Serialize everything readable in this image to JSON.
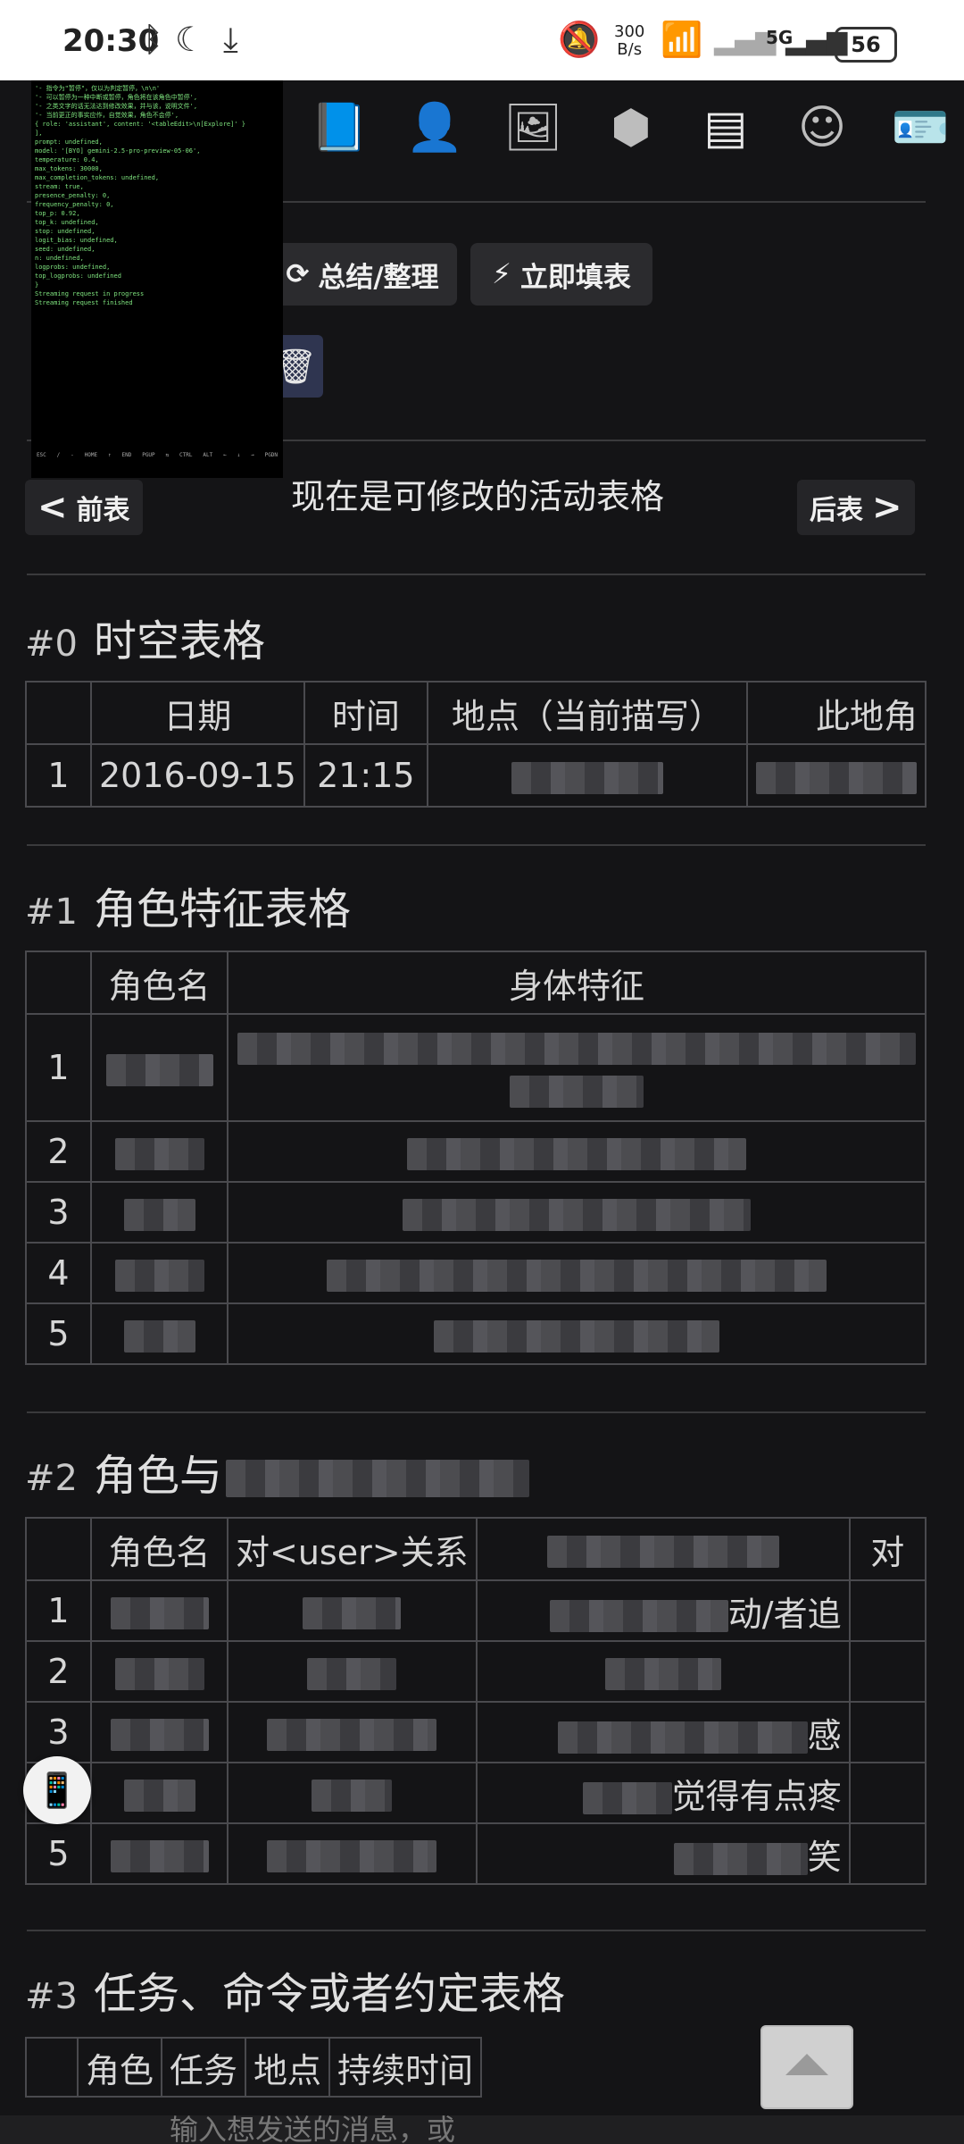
{
  "status_bar": {
    "time": "20:30",
    "net_speed_value": "300",
    "net_speed_unit": "B/s",
    "network": "5G",
    "battery": "56"
  },
  "top_nav": {
    "icons": [
      "book-globe-icon",
      "person-icon",
      "image-icon",
      "cubes-icon",
      "server-icon",
      "smiley-icon",
      "id-card-icon"
    ],
    "active": "server-icon"
  },
  "toolbar": {
    "summarize_label": "总结/整理",
    "fill_now_label": "立即填表"
  },
  "table_nav": {
    "prev_label": "前表",
    "next_label": "后表",
    "current_title": "现在是可修改的活动表格"
  },
  "debug_overlay": {
    "lines": [
      "  '- 指令为\"暂停\"，仅以为判定暂停，\\n\\n'",
      "  '- 可以暂停为一种中断或暂停，角色将在该角色中暂停',",
      "  '- 之类文字的话无法达到修改效果，并与该，说明文件',",
      "  '- 当前更正的事实应作，自觉效果，角色不会停',",
      "  { role: 'assistant', content: '<tableEdit>\\n[Explore]' }",
      "],",
      "prompt: undefined,",
      "model: '[BYO] gemini-2.5-pro-preview-05-06',",
      "temperature: 0.4,",
      "max_tokens: 30000,",
      "max_completion_tokens: undefined,",
      "stream: true,",
      "presence_penalty: 0,",
      "frequency_penalty: 0,",
      "top_p: 0.92,",
      "top_k: undefined,",
      "stop: undefined,",
      "logit_bias: undefined,",
      "seed: undefined,",
      "n: undefined,",
      "logprobs: undefined,",
      "top_logprobs: undefined",
      "}",
      "Streaming request in progress",
      "Streaming request finished"
    ],
    "keys": [
      "ESC",
      "/",
      "-",
      "HOME",
      "↑",
      "END",
      "PGUP",
      "⇆",
      "CTRL",
      "ALT",
      "←",
      "↓",
      "→",
      "PGDN"
    ]
  },
  "sections": [
    {
      "num": "#0",
      "title": "时空表格",
      "headers": [
        "",
        "日期",
        "时间",
        "地点（当前描写）",
        "此地角"
      ],
      "rows": [
        [
          "1",
          "2016-09-15",
          "21:15",
          "",
          ""
        ]
      ]
    },
    {
      "num": "#1",
      "title": "角色特征表格",
      "headers": [
        "",
        "角色名",
        "身体特征"
      ],
      "rows": [
        [
          "1",
          "",
          ""
        ],
        [
          "2",
          "",
          ""
        ],
        [
          "3",
          "",
          ""
        ],
        [
          "4",
          "",
          ""
        ],
        [
          "5",
          "",
          ""
        ]
      ]
    },
    {
      "num": "#2",
      "title": "角色与",
      "headers": [
        "",
        "角色名",
        "对<user>关系",
        "",
        "对"
      ],
      "rows": [
        [
          "1",
          "",
          "",
          "动/者追",
          ""
        ],
        [
          "2",
          "",
          "",
          "",
          ""
        ],
        [
          "3",
          "",
          "",
          "感",
          ""
        ],
        [
          "4",
          "",
          "",
          "觉得有点疼",
          ""
        ],
        [
          "5",
          "",
          "",
          "笑",
          ""
        ]
      ]
    },
    {
      "num": "#3",
      "title": "任务、命令或者约定表格",
      "headers": [
        "",
        "角色",
        "任务",
        "地点",
        "持续时间"
      ]
    }
  ],
  "input_bar": {
    "placeholder": "输入想发送的消息，或"
  }
}
